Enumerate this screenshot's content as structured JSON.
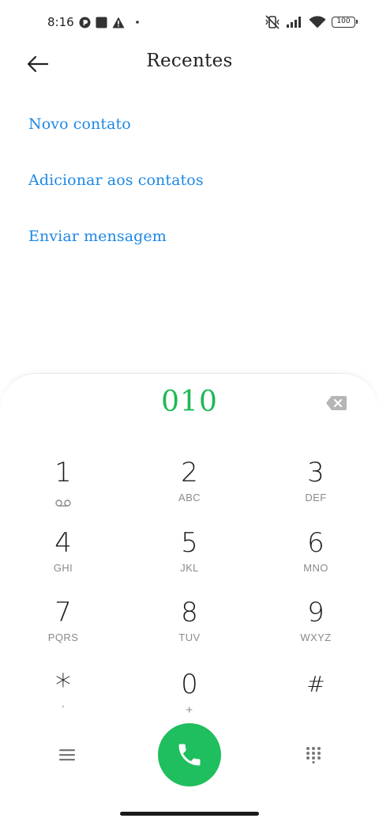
{
  "status_bar": {
    "time": "8:16",
    "battery": "100"
  },
  "header": {
    "title": "Recentes"
  },
  "options": [
    {
      "label": "Novo contato"
    },
    {
      "label": "Adicionar aos contatos"
    },
    {
      "label": "Enviar mensagem"
    }
  ],
  "dialer": {
    "number": "010",
    "keys": [
      {
        "digit": "1",
        "letters": ""
      },
      {
        "digit": "2",
        "letters": "ABC"
      },
      {
        "digit": "3",
        "letters": "DEF"
      },
      {
        "digit": "4",
        "letters": "GHI"
      },
      {
        "digit": "5",
        "letters": "JKL"
      },
      {
        "digit": "6",
        "letters": "MNO"
      },
      {
        "digit": "7",
        "letters": "PQRS"
      },
      {
        "digit": "8",
        "letters": "TUV"
      },
      {
        "digit": "9",
        "letters": "WXYZ"
      },
      {
        "digit": "*",
        "letters": ","
      },
      {
        "digit": "0",
        "letters": "+"
      },
      {
        "digit": "#",
        "letters": ""
      }
    ]
  },
  "colors": {
    "accent_blue": "#1e88e5",
    "number_green": "#1db954",
    "call_green": "#1fbe5e"
  },
  "icons": {
    "back": "arrow-left-icon",
    "backspace": "backspace-icon",
    "call": "phone-icon",
    "menu": "menu-icon",
    "keypad": "dialpad-icon",
    "voicemail": "voicemail-icon"
  }
}
